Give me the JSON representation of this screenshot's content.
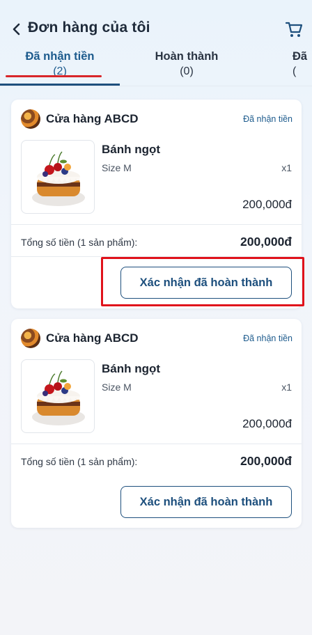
{
  "header": {
    "title": "Đơn hàng của tôi",
    "back_icon": "chevron-left-icon",
    "cart_icon": "cart-icon"
  },
  "tabs": [
    {
      "label": "Đã nhận tiền",
      "count": "(2)",
      "active": true
    },
    {
      "label": "Hoàn thành",
      "count": "(0)",
      "active": false
    },
    {
      "label": "Đã",
      "count": "(",
      "active": false
    }
  ],
  "orders": [
    {
      "store_name": "Cửa hàng ABCD",
      "status": "Đã nhận tiền",
      "product_name": "Bánh ngọt",
      "variant": "Size M",
      "quantity": "x1",
      "price": "200,000đ",
      "total_label": "Tổng số tiền (1 sản phẩm):",
      "total_value": "200,000đ",
      "confirm_label": "Xác nhận đã hoàn thành"
    },
    {
      "store_name": "Cửa hàng ABCD",
      "status": "Đã nhận tiền",
      "product_name": "Bánh ngọt",
      "variant": "Size M",
      "quantity": "x1",
      "price": "200,000đ",
      "total_label": "Tổng số tiền (1 sản phẩm):",
      "total_value": "200,000đ",
      "confirm_label": "Xác nhận đã hoàn thành"
    }
  ],
  "colors": {
    "accent": "#1d4f7d",
    "tab_active_text": "#1d5b8d",
    "annotation_red": "#e0121b"
  }
}
